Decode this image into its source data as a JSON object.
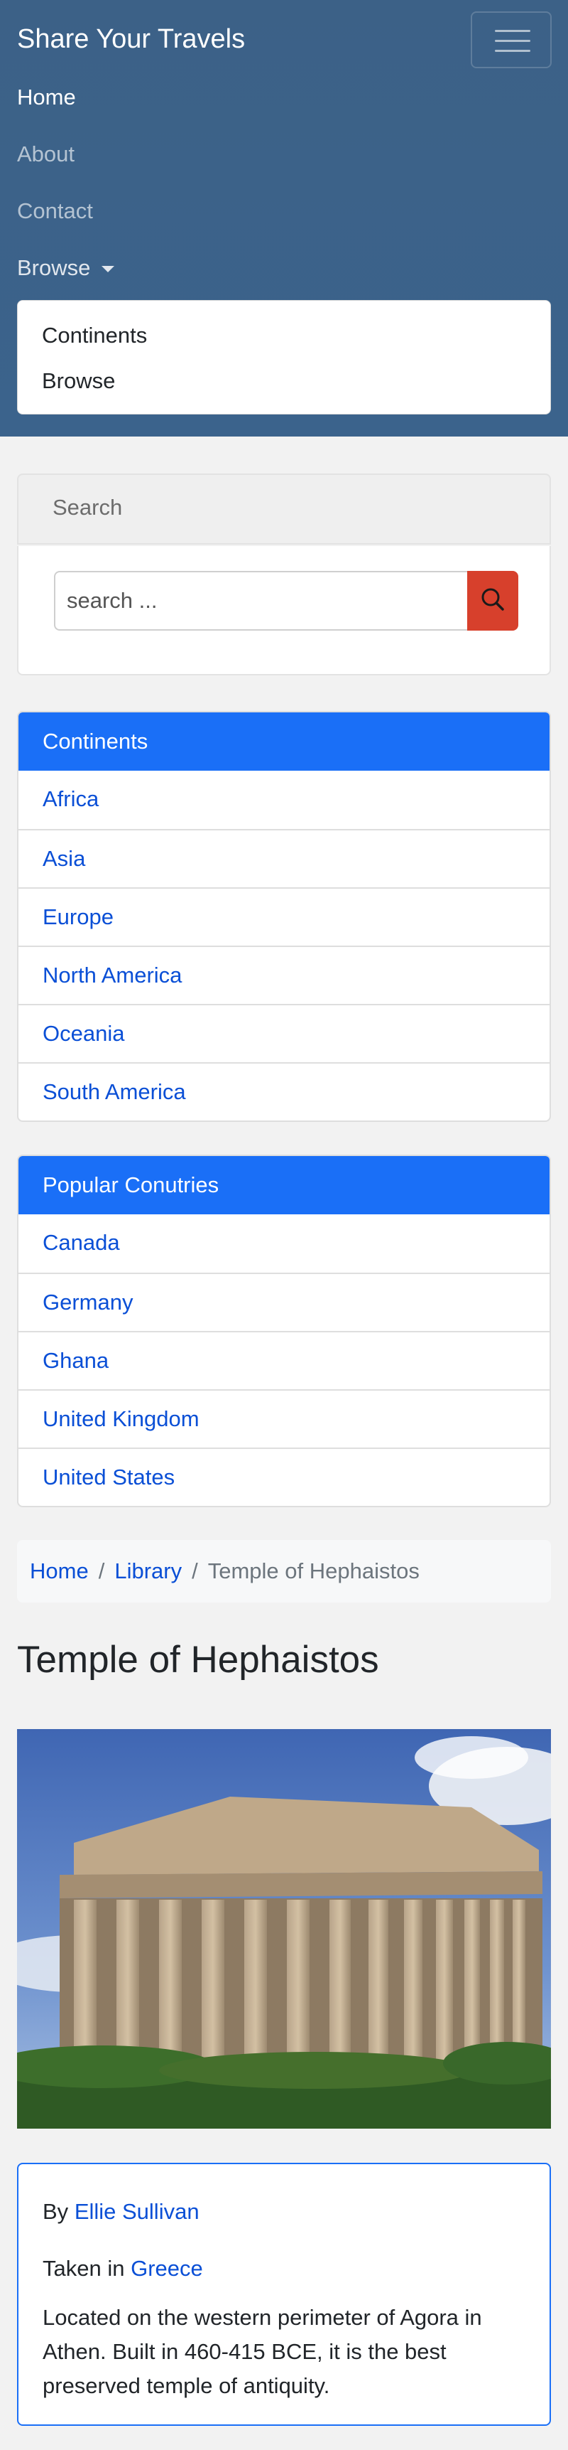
{
  "header": {
    "brand": "Share Your Travels",
    "nav": {
      "home": "Home",
      "about": "About",
      "contact": "Contact",
      "browse": "Browse"
    },
    "dropdown": [
      "Continents",
      "Browse"
    ]
  },
  "search": {
    "heading": "Search",
    "placeholder": "search ..."
  },
  "continents": {
    "heading": "Continents",
    "items": [
      "Africa",
      "Asia",
      "Europe",
      "North America",
      "Oceania",
      "South America"
    ]
  },
  "countries": {
    "heading": "Popular Conutries",
    "items": [
      "Canada",
      "Germany",
      "Ghana",
      "United Kingdom",
      "United States"
    ]
  },
  "breadcrumb": {
    "home": "Home",
    "library": "Library",
    "current": "Temple of Hephaistos"
  },
  "photo_page": {
    "title": "Temple of Hephaistos",
    "by_label": "By",
    "author": "Ellie Sullivan",
    "taken_label": "Taken in",
    "country": "Greece",
    "description": "Located on the western perimeter of Agora in Athen. Built in 460-415 BCE, it is the best preserved temple of antiquity."
  },
  "colors": {
    "navbar": "#3b638c",
    "card_header": "#1a6ff7",
    "link": "#0a4fd6",
    "search_button": "#d7402c"
  }
}
